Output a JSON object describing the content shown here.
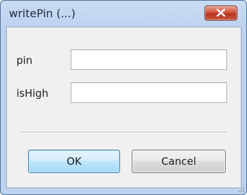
{
  "window": {
    "title": "writePin (...)"
  },
  "form": {
    "fields": [
      {
        "label": "pin",
        "value": ""
      },
      {
        "label": "isHigh",
        "value": ""
      }
    ]
  },
  "buttons": {
    "ok_label": "OK",
    "cancel_label": "Cancel"
  },
  "icons": {
    "close": "close-icon",
    "resize": "resize-grip-icon"
  },
  "colors": {
    "close_button": "#c8553e",
    "ok_button_border": "#3c7fb1",
    "window_frame": "#bcd2ee"
  }
}
